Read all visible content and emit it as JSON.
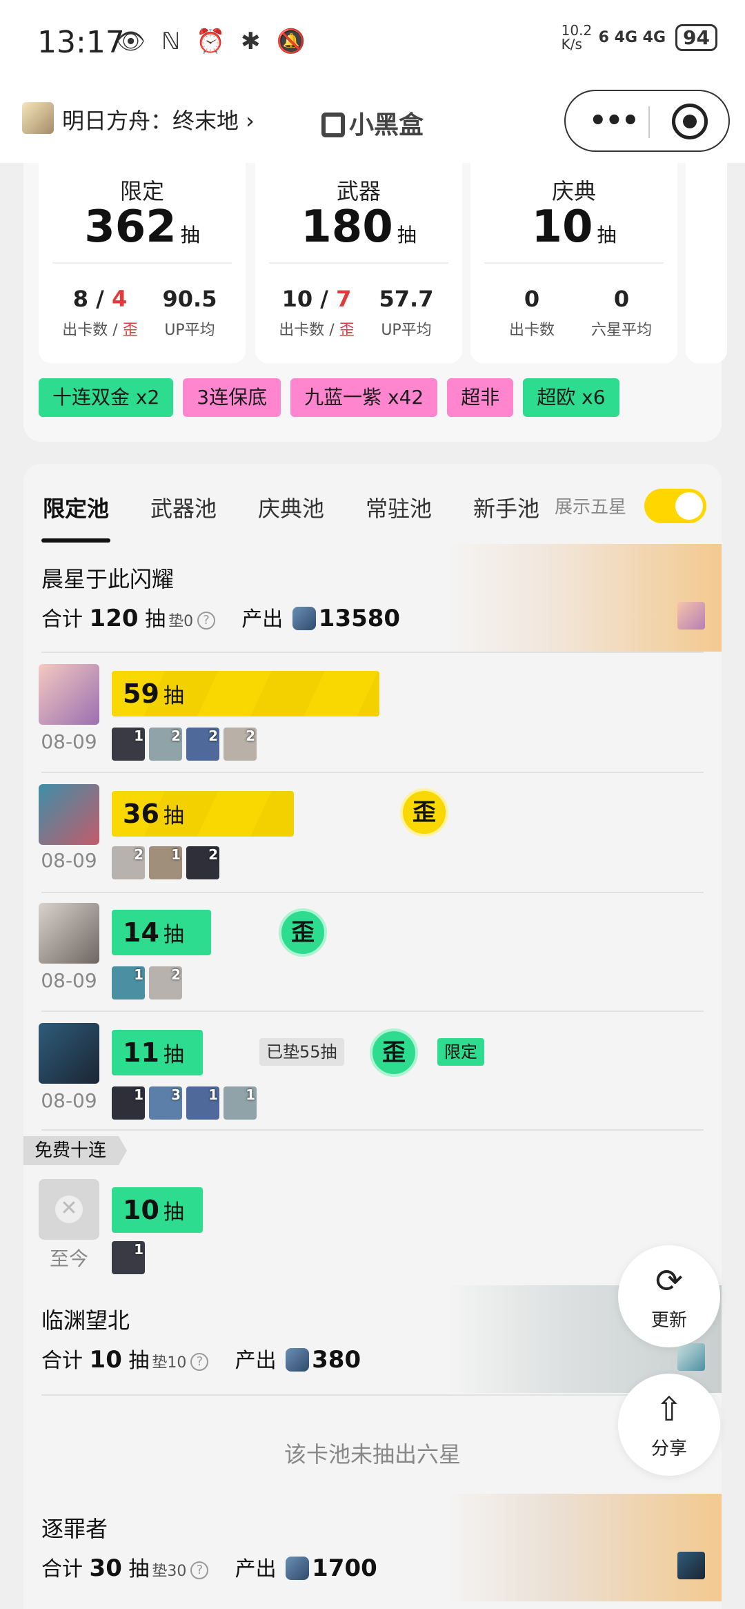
{
  "status_bar": {
    "time": "13:17",
    "icons": "👁 ℕ ⏰ ✱ 🔕",
    "speed": "10.2 K/s",
    "network": "6 4G 4G",
    "battery": "94"
  },
  "header": {
    "app_title": "明日方舟：终末地 ›",
    "brand": "小黑盒",
    "more_icon": "•••"
  },
  "summary": {
    "cards": [
      {
        "name": "限定",
        "count": "362",
        "unit": "抽",
        "v1_a": "8",
        "v1_sep": " / ",
        "v1_b": "4",
        "v2": "90.5",
        "l1_a": "出卡数 / ",
        "l1_b": "歪",
        "l2": "UP平均"
      },
      {
        "name": "武器",
        "count": "180",
        "unit": "抽",
        "v1_a": "10",
        "v1_sep": " / ",
        "v1_b": "7",
        "v2": "57.7",
        "l1_a": "出卡数 / ",
        "l1_b": "歪",
        "l2": "UP平均"
      },
      {
        "name": "庆典",
        "count": "10",
        "unit": "抽",
        "v1_a": "0",
        "v2": "0",
        "l1_a": "出卡数",
        "l2": "六星平均"
      }
    ],
    "tags": [
      "十连双金 x2",
      "3连保底",
      "九蓝一紫 x42",
      "超非",
      "超欧 x6"
    ]
  },
  "tabs": [
    "限定池",
    "武器池",
    "庆典池",
    "常驻池",
    "新手池"
  ],
  "toggle_label": "展示五星",
  "pools": [
    {
      "title": "晨星于此闪耀",
      "sum_prefix": "合计",
      "total": "120",
      "unit": "抽",
      "pad": "垫0",
      "output_label": "产出",
      "output": "13580"
    },
    {
      "title": "临渊望北",
      "sum_prefix": "合计",
      "total": "10",
      "unit": "抽",
      "pad": "垫10",
      "output_label": "产出",
      "output": "380"
    },
    {
      "title": "逐罪者",
      "sum_prefix": "合计",
      "total": "30",
      "unit": "抽",
      "pad": "垫30",
      "output_label": "产出",
      "output": "1700"
    }
  ],
  "rows": [
    {
      "pulls": "59",
      "unit": "抽",
      "date": "08-09",
      "minis": [
        "1",
        "2",
        "2",
        "2"
      ]
    },
    {
      "pulls": "36",
      "unit": "抽",
      "date": "08-09",
      "wai": "歪",
      "minis": [
        "2",
        "1",
        "2"
      ]
    },
    {
      "pulls": "14",
      "unit": "抽",
      "date": "08-09",
      "wai": "歪",
      "minis": [
        "1",
        "2"
      ]
    },
    {
      "pulls": "11",
      "unit": "抽",
      "date": "08-09",
      "pad_chip": "已垫55抽",
      "wai": "歪",
      "limited": "限定",
      "minis": [
        "1",
        "3",
        "1",
        "1"
      ]
    }
  ],
  "free": {
    "banner": "免费十连",
    "pulls": "10",
    "unit": "抽",
    "date": "至今",
    "minis": [
      "1"
    ],
    "x_icon": "✕"
  },
  "no_six": "该卡池未抽出六星",
  "fabs": {
    "refresh_label": "更新",
    "refresh_icon": "⟳",
    "share_label": "分享",
    "share_icon": "⇧"
  }
}
